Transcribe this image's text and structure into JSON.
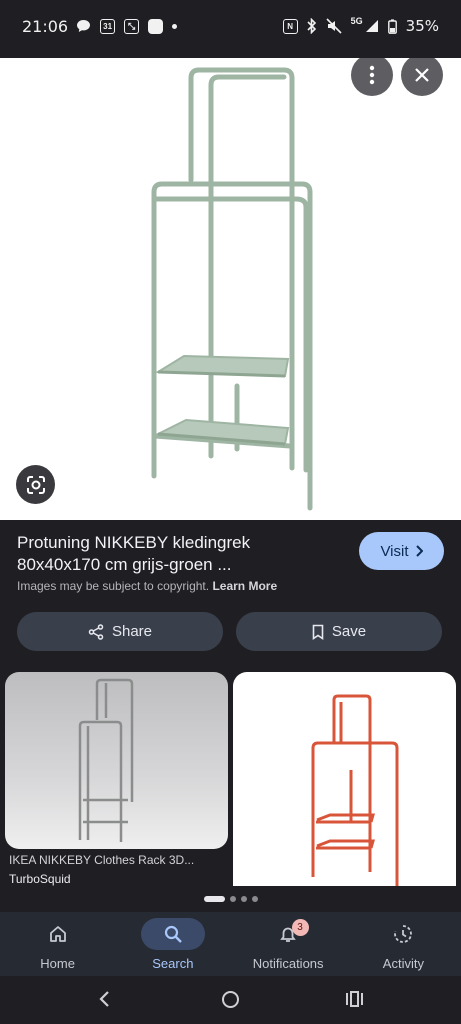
{
  "status_bar": {
    "time": "21:06",
    "calendar_day": "31",
    "network": "5G",
    "battery": "35%"
  },
  "result": {
    "title": "Protuning NIKKEBY kledingrek 80x40x170 cm grijs-groen ...",
    "visit_label": "Visit",
    "copyright_text": "Images may be subject to copyright.",
    "learn_more": "Learn More",
    "share_label": "Share",
    "save_label": "Save"
  },
  "related": [
    {
      "caption": "IKEA NIKKEBY Clothes Rack 3D...",
      "source": "TurboSquid"
    },
    {
      "caption": "",
      "source": ""
    }
  ],
  "bottom_nav": {
    "items": [
      {
        "label": "Home",
        "icon": "home-icon",
        "active": false
      },
      {
        "label": "Search",
        "icon": "search-icon",
        "active": true
      },
      {
        "label": "Notifications",
        "icon": "bell-icon",
        "active": false,
        "badge": "3"
      },
      {
        "label": "Activity",
        "icon": "activity-icon",
        "active": false
      }
    ]
  },
  "colors": {
    "background": "#1f1f23",
    "accent": "#a8c7fa",
    "rack_green": "#9fb5a3",
    "rack_red": "#d9553a"
  }
}
